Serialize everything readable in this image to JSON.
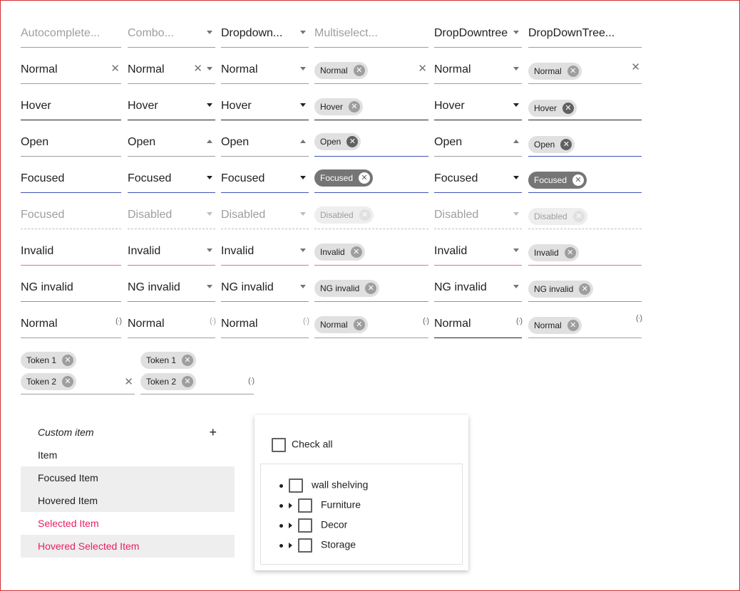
{
  "rows": [
    {
      "c0": "Autocomplete...",
      "c1": "Combo...",
      "c2": "Dropdown...",
      "c3": "Multiselect...",
      "c4": "DropDowntree",
      "c5": "DropDownTree..."
    },
    {
      "c0": "Normal",
      "c1": "Normal",
      "c2": "Normal",
      "c3": "Normal",
      "c4": "Normal",
      "c5": "Normal"
    },
    {
      "c0": "Hover",
      "c1": "Hover",
      "c2": "Hover",
      "c3": "Hover",
      "c4": "Hover",
      "c5": "Hover"
    },
    {
      "c0": "Open",
      "c1": "Open",
      "c2": "Open",
      "c3": "Open",
      "c4": "Open",
      "c5": "Open"
    },
    {
      "c0": "Focused",
      "c1": "Focused",
      "c2": "Focused",
      "c3": "Focused",
      "c4": "Focused",
      "c5": "Focused"
    },
    {
      "c0": "Focused",
      "c1": "Disabled",
      "c2": "Disabled",
      "c3": "Disabled",
      "c4": "Disabled",
      "c5": "Disabled"
    },
    {
      "c0": "Invalid",
      "c1": "Invalid",
      "c2": "Invalid",
      "c3": "Invalid",
      "c4": "Invalid",
      "c5": "Invalid"
    },
    {
      "c0": "NG invalid",
      "c1": "NG invalid",
      "c2": "NG invalid",
      "c3": "NG invalid",
      "c4": "NG invalid",
      "c5": "NG invalid"
    },
    {
      "c0": "Normal",
      "c1": "Normal",
      "c2": "Normal",
      "c3": "Normal",
      "c4": "Normal",
      "c5": "Normal"
    }
  ],
  "icons": {
    "clear": "✕",
    "chip_remove": "✕",
    "loading": "(·)"
  },
  "tokens": {
    "t1": "Token 1",
    "t2": "Token 2"
  },
  "list": {
    "custom": "Custom item",
    "plus": "+",
    "item": "Item",
    "focused": "Focused Item",
    "hovered": "Hovered Item",
    "selected": "Selected Item",
    "hovered_selected": "Hovered Selected Item"
  },
  "tree": {
    "check_all": "Check all",
    "nodes": [
      "wall shelving",
      "Furniture",
      "Decor",
      "Storage"
    ]
  },
  "colors": {
    "accent": "#3f51b5",
    "invalid": "#e57373",
    "selected": "#e91e63",
    "border": "#d32f2f"
  }
}
